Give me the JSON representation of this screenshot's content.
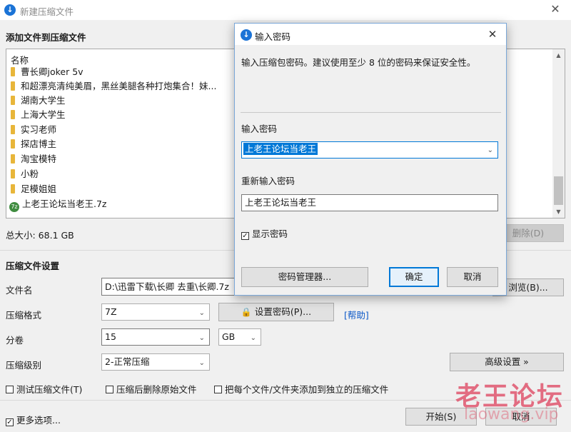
{
  "window": {
    "title": "新建压缩文件",
    "close_glyph": "✕",
    "icon": "download-arrow-icon"
  },
  "add_section": {
    "heading": "添加文件到压缩文件"
  },
  "file_list": {
    "header": "名称",
    "items": [
      {
        "name": "曹长卿joker 5v",
        "type": "folder"
      },
      {
        "name": "和超漂亮清纯美眉，黑丝美腿各种打炮集合！妹...",
        "type": "folder"
      },
      {
        "name": "湖南大学生",
        "type": "folder"
      },
      {
        "name": "上海大学生",
        "type": "folder"
      },
      {
        "name": "实习老师",
        "type": "folder"
      },
      {
        "name": "探店博主",
        "type": "folder"
      },
      {
        "name": "淘宝模特",
        "type": "folder"
      },
      {
        "name": "小粉",
        "type": "folder"
      },
      {
        "name": "足模姐姐",
        "type": "folder"
      },
      {
        "name": "上老王论坛当老王.7z",
        "type": "archive"
      }
    ],
    "archive_badge": "7z"
  },
  "total_size": "总大小: 68.1 GB",
  "delete_button": "删除(D)",
  "settings": {
    "heading": "压缩文件设置",
    "filename_label": "文件名",
    "filename_value": "D:\\迅雷下载\\长卿 去重\\长卿.7z",
    "browse_button": "浏览(B)...",
    "format_label": "压缩格式",
    "format_value": "7Z",
    "set_password_button": "设置密码(P)...",
    "help_link": "[帮助]",
    "volume_label": "分卷",
    "volume_value": "15",
    "volume_unit": "GB",
    "level_label": "压缩级别",
    "level_value": "2-正常压缩",
    "advanced_button": "高级设置 »",
    "test_checkbox": "测试压缩文件(T)",
    "delete_after_checkbox": "压缩后删除原始文件",
    "each_separate_checkbox": "把每个文件/文件夹添加到独立的压缩文件"
  },
  "more_options": {
    "label": "更多选项...",
    "checked": true
  },
  "start_button": "开始(S)",
  "cancel_button": "取消",
  "watermark": {
    "title": "老王论坛",
    "url": "laowang.vip",
    "color": "#e0566e"
  },
  "dialog": {
    "title": "输入密码",
    "description": "输入压缩包密码。建议使用至少 8 位的密码来保证安全性。",
    "password_label": "输入密码",
    "password_value": "上老王论坛当老王",
    "reenter_label": "重新输入密码",
    "reenter_value": "上老王论坛当老王",
    "show_password": "显示密码",
    "password_manager_button": "密码管理器...",
    "ok_button": "确定",
    "cancel_button": "取消",
    "close_glyph": "✕",
    "checkmark": "✓"
  },
  "colors": {
    "accent": "#0078d7",
    "selection": "#0078d7",
    "folder": "#e8b63a"
  }
}
